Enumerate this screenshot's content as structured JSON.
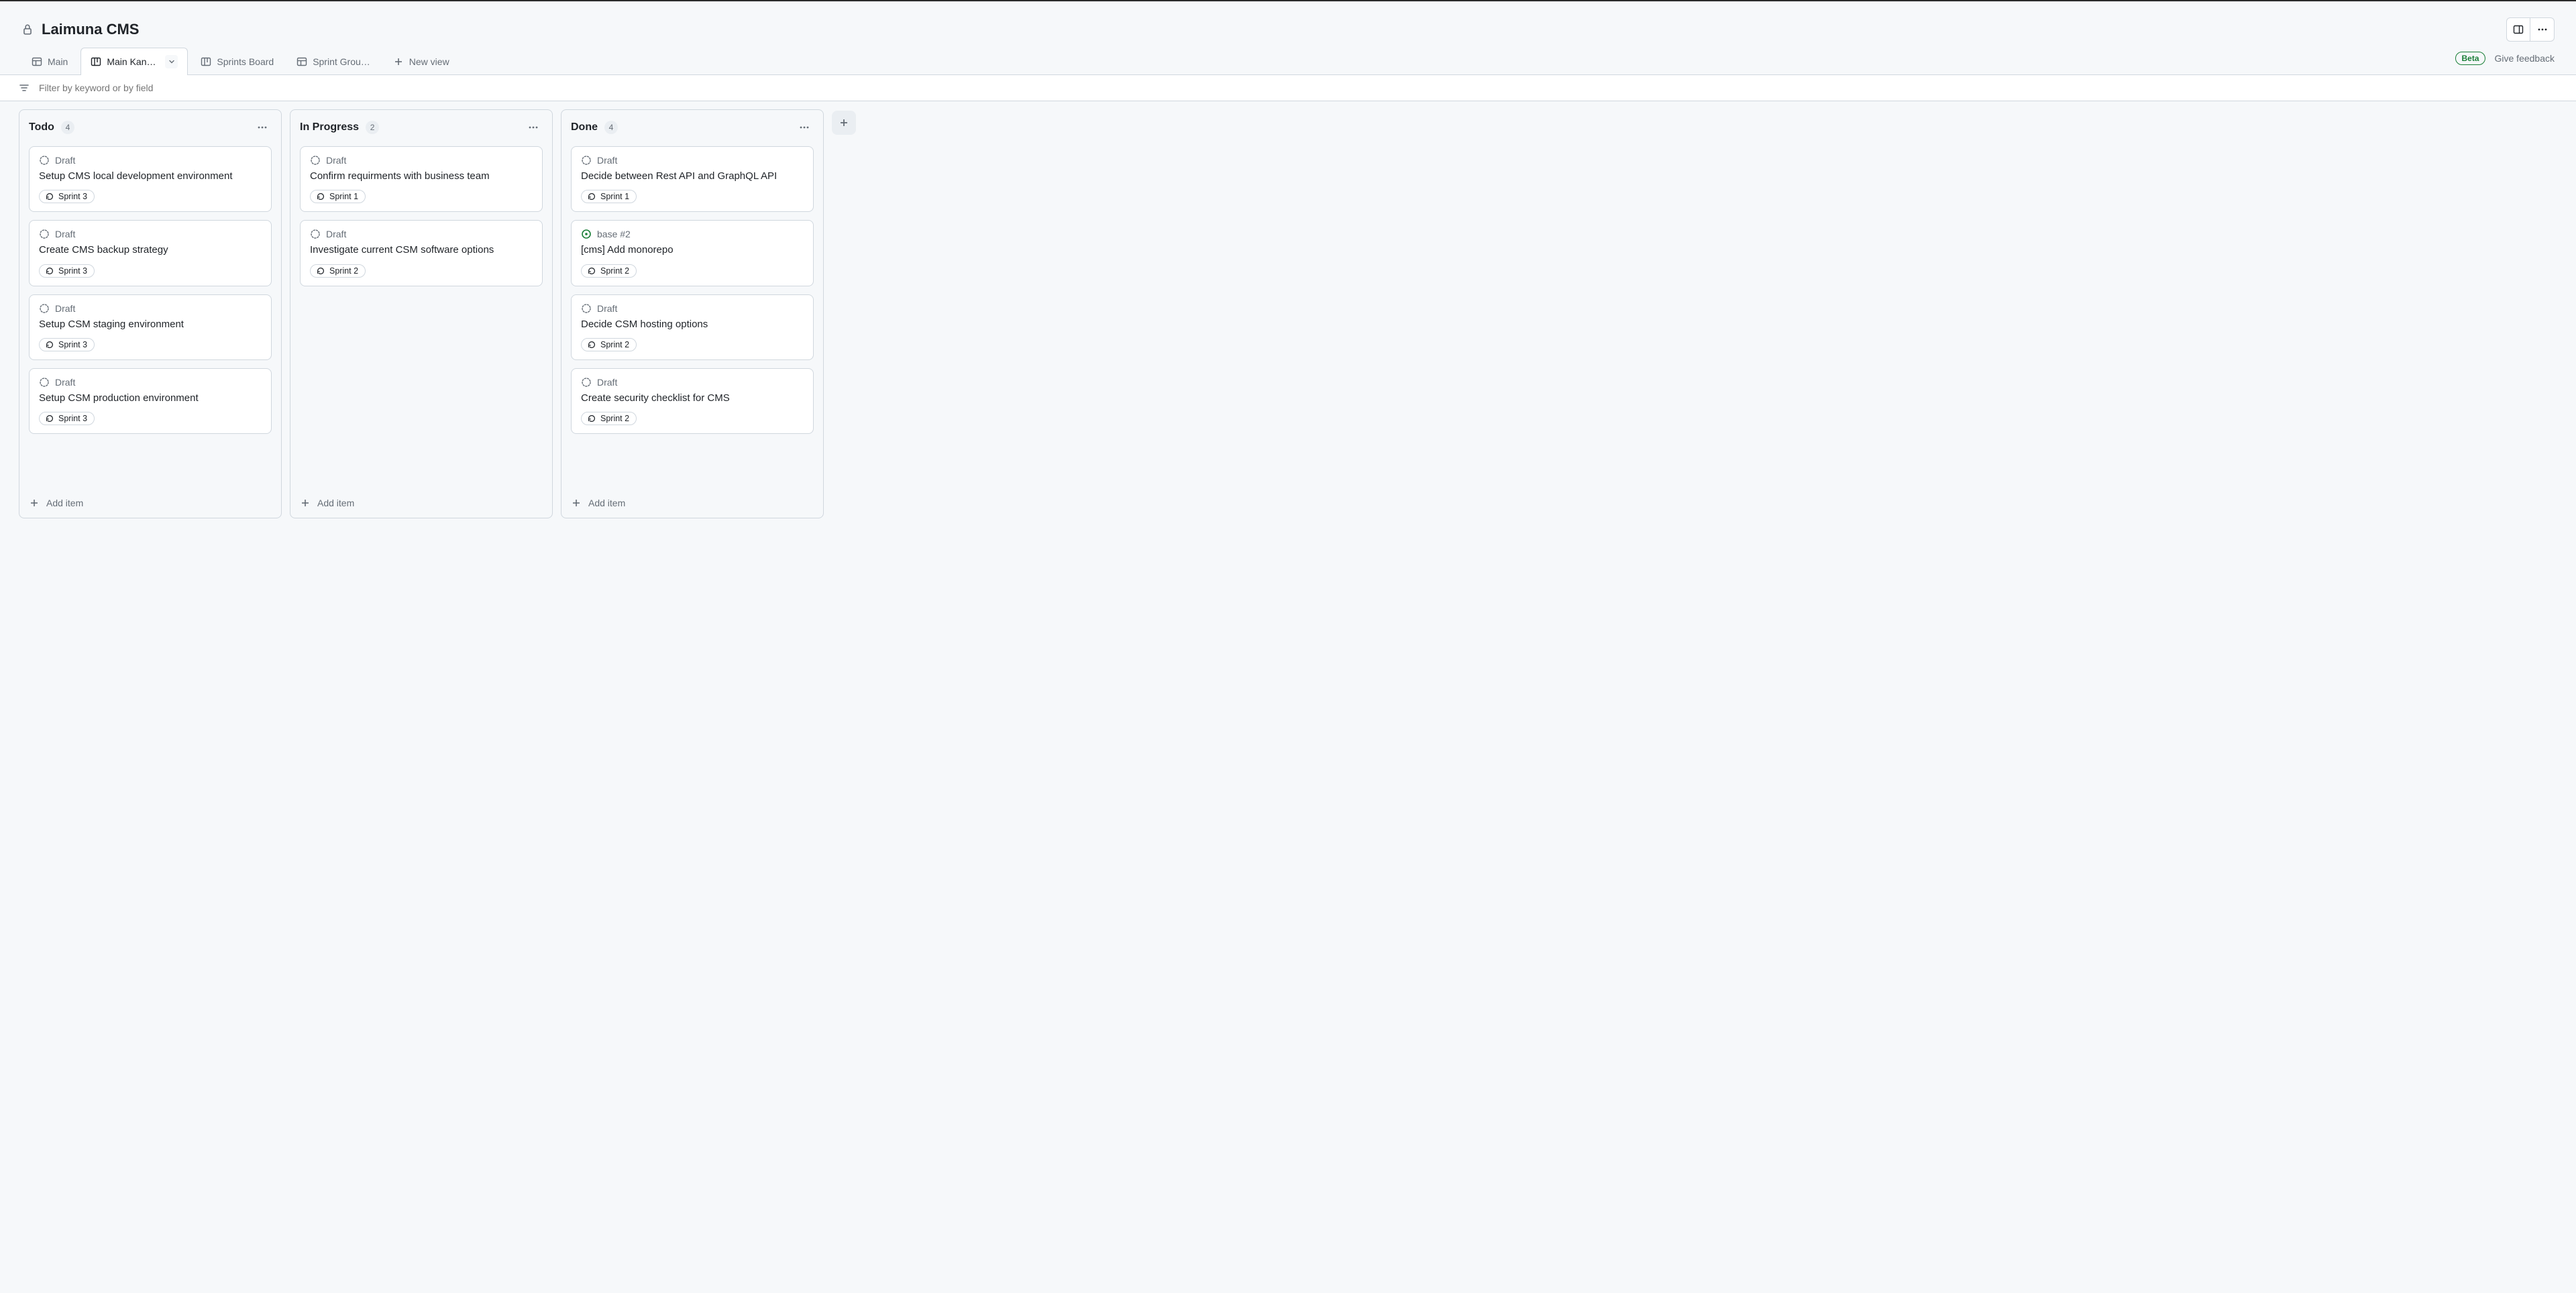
{
  "header": {
    "title": "Laimuna CMS"
  },
  "tabs": [
    {
      "label": "Main",
      "icon": "table",
      "active": false
    },
    {
      "label": "Main Kanban",
      "icon": "kanban",
      "active": true
    },
    {
      "label": "Sprints Board",
      "icon": "kanban",
      "active": false
    },
    {
      "label": "Sprint Grou…",
      "icon": "table",
      "active": false
    }
  ],
  "new_view_label": "New view",
  "beta_label": "Beta",
  "feedback_label": "Give feedback",
  "filter_placeholder": "Filter by keyword or by field",
  "add_item_label": "Add item",
  "columns": [
    {
      "title": "Todo",
      "count": "4",
      "cards": [
        {
          "status": "Draft",
          "statusType": "draft",
          "title": "Setup CMS local development environment",
          "sprint": "Sprint 3"
        },
        {
          "status": "Draft",
          "statusType": "draft",
          "title": "Create CMS backup strategy",
          "sprint": "Sprint 3"
        },
        {
          "status": "Draft",
          "statusType": "draft",
          "title": "Setup CSM staging environment",
          "sprint": "Sprint 3"
        },
        {
          "status": "Draft",
          "statusType": "draft",
          "title": "Setup CSM production environment",
          "sprint": "Sprint 3"
        }
      ]
    },
    {
      "title": "In Progress",
      "count": "2",
      "cards": [
        {
          "status": "Draft",
          "statusType": "draft",
          "title": "Confirm requirments with business team",
          "sprint": "Sprint 1"
        },
        {
          "status": "Draft",
          "statusType": "draft",
          "title": "Investigate current CSM software options",
          "sprint": "Sprint 2"
        }
      ]
    },
    {
      "title": "Done",
      "count": "4",
      "cards": [
        {
          "status": "Draft",
          "statusType": "draft",
          "title": "Decide between Rest API and GraphQL API",
          "sprint": "Sprint 1"
        },
        {
          "status": "base #2",
          "statusType": "issue",
          "title": "[cms] Add monorepo",
          "sprint": "Sprint 2"
        },
        {
          "status": "Draft",
          "statusType": "draft",
          "title": "Decide CSM hosting options",
          "sprint": "Sprint 2"
        },
        {
          "status": "Draft",
          "statusType": "draft",
          "title": "Create security checklist for CMS",
          "sprint": "Sprint 2"
        }
      ]
    }
  ]
}
